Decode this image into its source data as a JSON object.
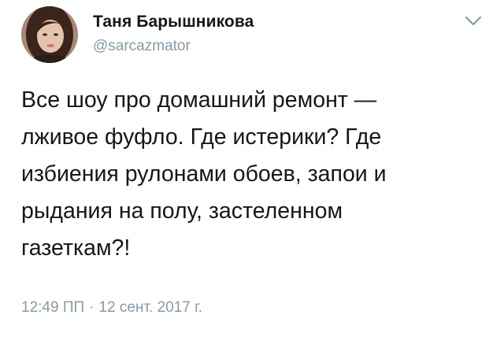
{
  "author": {
    "name": "Таня Барышникова",
    "handle": "@sarcazmator"
  },
  "tweet": {
    "lines": [
      "Все шоу про домашний ремонт —",
      "лживое фуфло. Где истерики? Где",
      "избиения рулонами обоев, запои и",
      "рыдания на полу, застеленном",
      "газеткам?!"
    ],
    "time": "12:49 ПП",
    "separator": "·",
    "date": "12 сент. 2017 г."
  },
  "icons": {
    "avatar": "profile-photo",
    "menu": "chevron-down-icon"
  },
  "colors": {
    "text": "#14171a",
    "muted": "#8899a6"
  }
}
